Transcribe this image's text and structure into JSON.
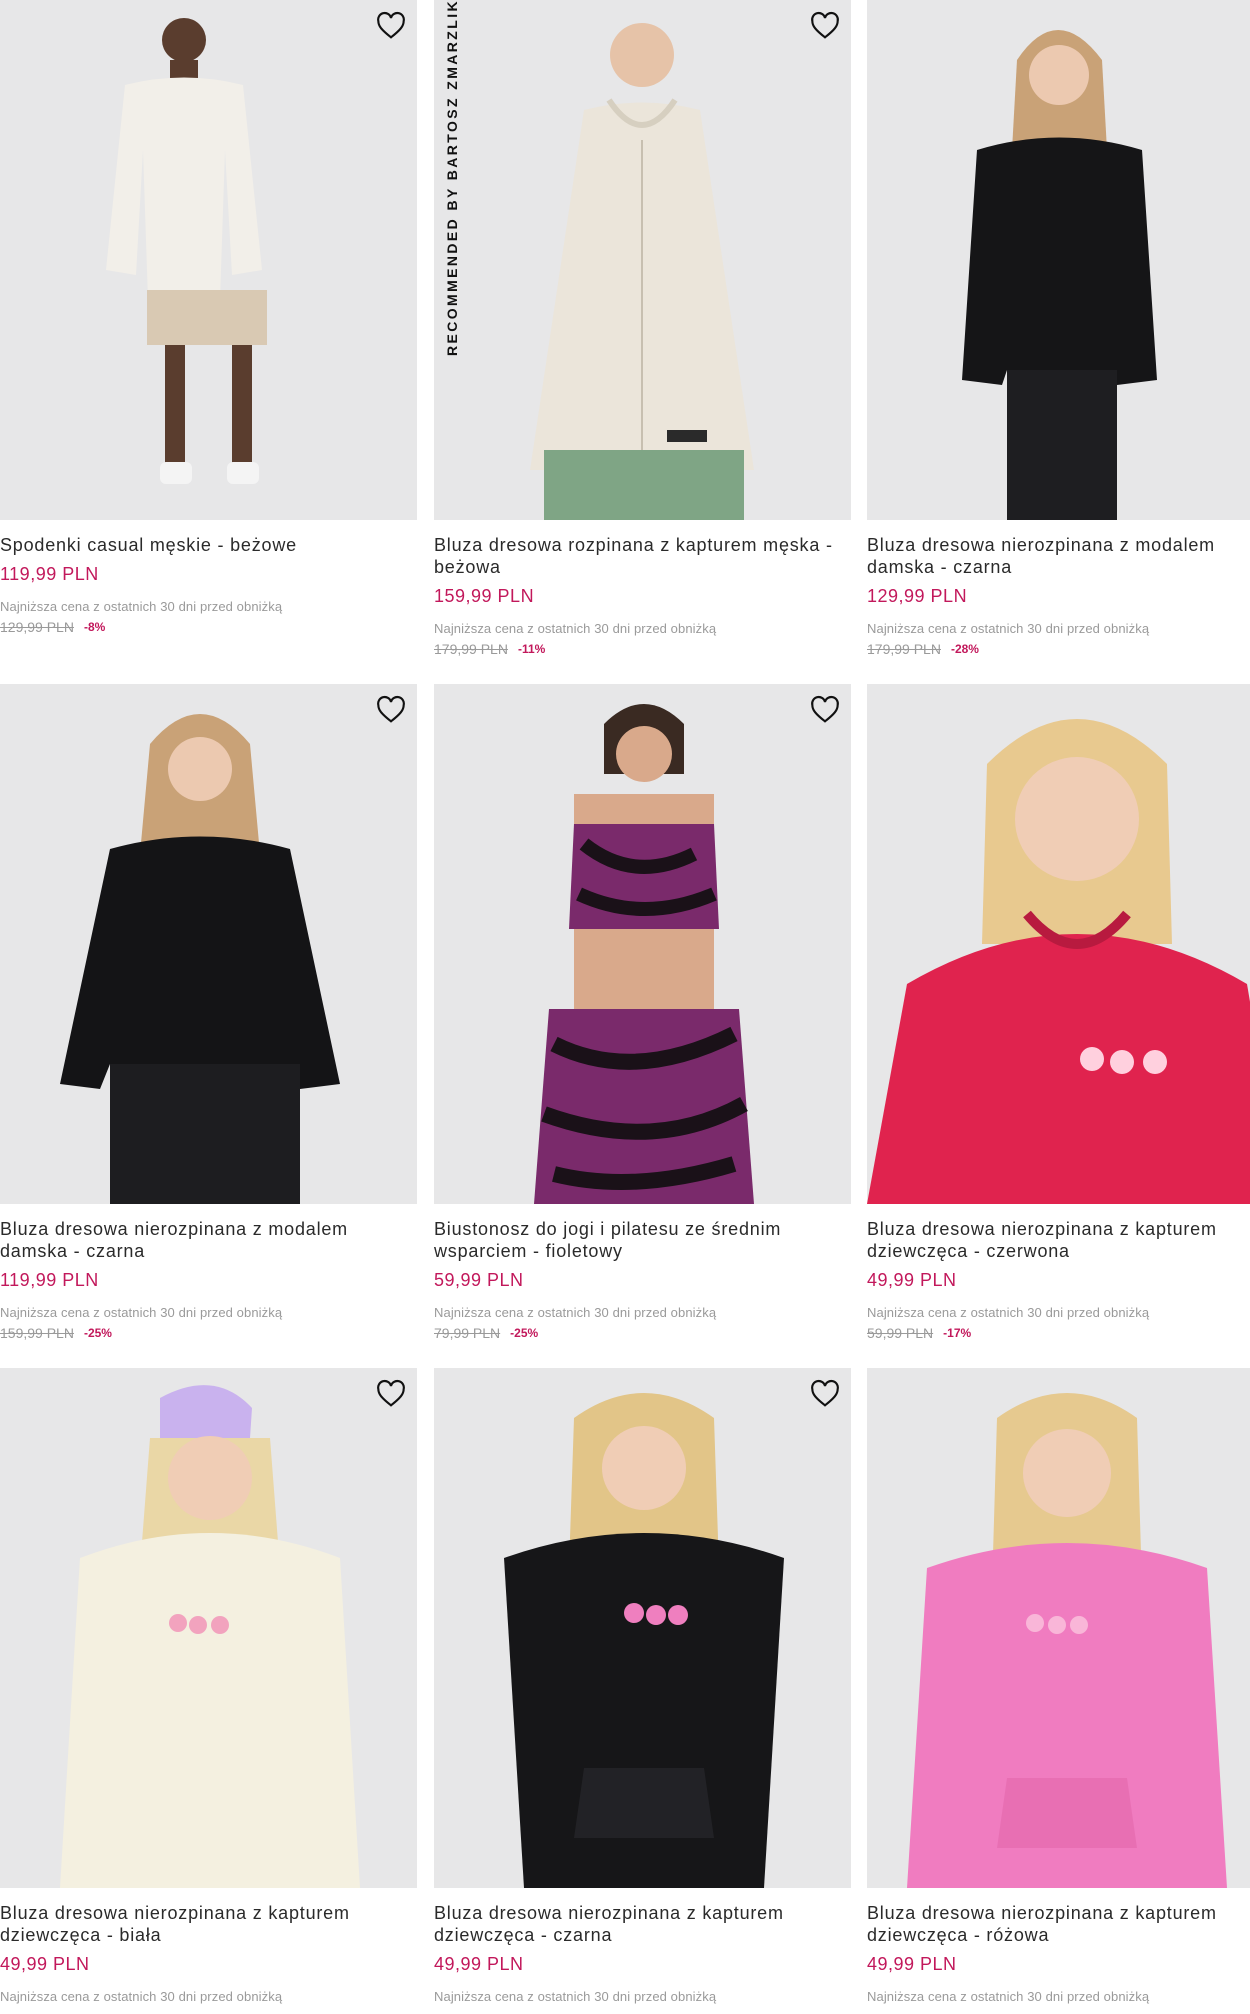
{
  "lowest_label": "Najniższa cena z ostatnich 30 dni przed obniżką",
  "recommended_tag": "RECOMMENDED BY BARTOSZ ZMARZLIK",
  "colors": {
    "price": "#c2185b",
    "muted": "#9a9a9a",
    "photo_bg": "#e7e7e8"
  },
  "products": [
    {
      "name": "Spodenki casual męskie - beżowe",
      "price": "119,99 PLN",
      "old_price": "129,99 PLN",
      "discount": "-8%",
      "garment_color": "#f2efe9",
      "recommended": false,
      "icon": "heart-outline-icon"
    },
    {
      "name": "Bluza dresowa rozpinana z kapturem męska - beżowa",
      "price": "159,99 PLN",
      "old_price": "179,99 PLN",
      "discount": "-11%",
      "garment_color": "#ebe5da",
      "recommended": true,
      "icon": "heart-outline-icon"
    },
    {
      "name": "Bluza dresowa nierozpinana z modalem damska - czarna",
      "price": "129,99 PLN",
      "old_price": "179,99 PLN",
      "discount": "-28%",
      "garment_color": "#151517",
      "recommended": false,
      "icon": "heart-outline-icon"
    },
    {
      "name": "Bluza dresowa nierozpinana z modalem damska - czarna",
      "price": "119,99 PLN",
      "old_price": "159,99 PLN",
      "discount": "-25%",
      "garment_color": "#141416",
      "recommended": false,
      "icon": "heart-outline-icon"
    },
    {
      "name": "Biustonosz do jogi i pilatesu ze średnim wsparciem - fioletowy",
      "price": "59,99 PLN",
      "old_price": "79,99 PLN",
      "discount": "-25%",
      "garment_color": "#7a2a6b",
      "recommended": false,
      "icon": "heart-outline-icon"
    },
    {
      "name": "Bluza dresowa nierozpinana z kapturem dziewczęca - czerwona",
      "price": "49,99 PLN",
      "old_price": "59,99 PLN",
      "discount": "-17%",
      "garment_color": "#e0234e",
      "recommended": false,
      "icon": "heart-outline-icon"
    },
    {
      "name": "Bluza dresowa nierozpinana z kapturem dziewczęca - biała",
      "price": "49,99 PLN",
      "old_price": "",
      "discount": "",
      "garment_color": "#f4f0e0",
      "recommended": false,
      "icon": "heart-outline-icon"
    },
    {
      "name": "Bluza dresowa nierozpinana z kapturem dziewczęca - czarna",
      "price": "49,99 PLN",
      "old_price": "",
      "discount": "",
      "garment_color": "#161618",
      "recommended": false,
      "icon": "heart-outline-icon"
    },
    {
      "name": "Bluza dresowa nierozpinana z kapturem dziewczęca - różowa",
      "price": "49,99 PLN",
      "old_price": "",
      "discount": "",
      "garment_color": "#f07cc0",
      "recommended": false,
      "icon": "heart-outline-icon"
    }
  ]
}
